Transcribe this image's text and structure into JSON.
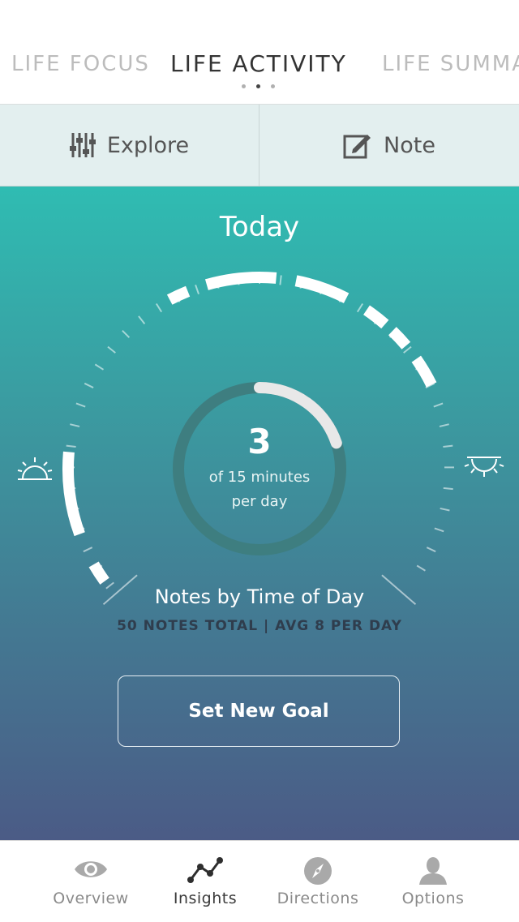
{
  "pager": {
    "tabs": [
      {
        "label": "LIFE FOCUS"
      },
      {
        "label": "LIFE ACTIVITY"
      },
      {
        "label": "LIFE SUMMARY"
      }
    ],
    "active_index": 1
  },
  "actions": {
    "explore_label": "Explore",
    "note_label": "Note"
  },
  "panel": {
    "title": "Today",
    "goal_value": "3",
    "goal_line1": "of 15 minutes",
    "goal_line2": "per day",
    "goal_progress": 0.2,
    "chart_title": "Notes by Time of Day",
    "chart_stats": "50 NOTES TOTAL | AVG 8 PER DAY",
    "set_goal_label": "Set New Goal"
  },
  "icons": {
    "sunrise": "sunrise-icon",
    "sunset": "sunset-icon",
    "explore": "sliders-icon",
    "note": "edit-note-icon"
  },
  "tabbar": {
    "items": [
      {
        "label": "Overview",
        "icon": "eye-icon"
      },
      {
        "label": "Insights",
        "icon": "line-chart-icon"
      },
      {
        "label": "Directions",
        "icon": "compass-icon"
      },
      {
        "label": "Options",
        "icon": "user-icon"
      }
    ],
    "active_index": 1
  },
  "colors": {
    "gradient_top": "#2fbcb2",
    "gradient_bottom": "#4b5b86",
    "ring_track": "#3e7e80",
    "ring_fill": "#e8e8e8"
  }
}
